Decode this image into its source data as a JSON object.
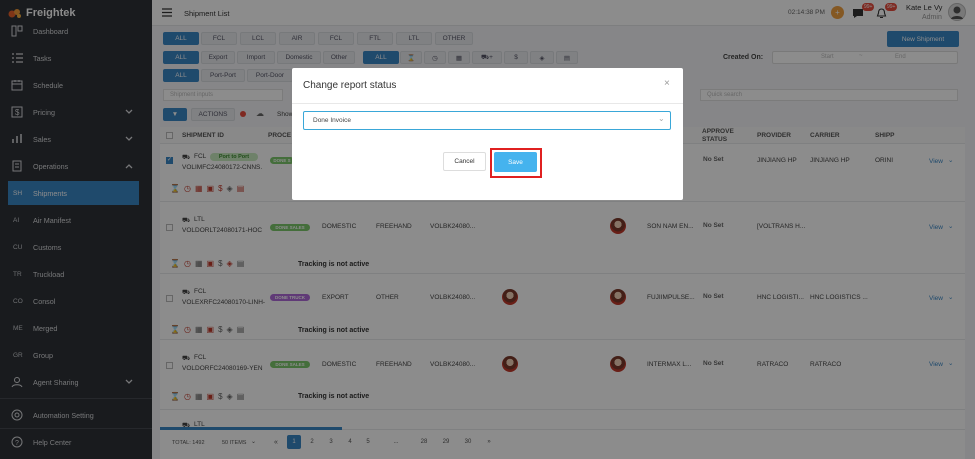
{
  "sidebar": {
    "brand": "Freightek",
    "items": [
      {
        "label": "Dashboard",
        "icon": "dashboard-icon"
      },
      {
        "label": "Tasks",
        "icon": "tasks-icon"
      },
      {
        "label": "Schedule",
        "icon": "calendar-icon"
      },
      {
        "label": "Pricing",
        "icon": "pricing-icon",
        "chevron": "down"
      },
      {
        "label": "Sales",
        "icon": "sales-icon",
        "chevron": "down"
      },
      {
        "label": "Operations",
        "icon": "operations-icon",
        "chevron": "up"
      }
    ],
    "sub_items": [
      {
        "abbr": "SH",
        "label": "Shipments",
        "active": true
      },
      {
        "abbr": "AI",
        "label": "Air Manifest"
      },
      {
        "abbr": "CU",
        "label": "Customs"
      },
      {
        "abbr": "TR",
        "label": "Truckload"
      },
      {
        "abbr": "CO",
        "label": "Consol"
      },
      {
        "abbr": "ME",
        "label": "Merged"
      },
      {
        "abbr": "GR",
        "label": "Group"
      }
    ],
    "agent_sharing": "Agent Sharing",
    "automation_setting": "Automation Setting",
    "help_center": "Help Center"
  },
  "topbar": {
    "title": "Shipment List",
    "time": "02:14:38 PM",
    "msg_badge": "99+",
    "notif_badge": "99+",
    "user_name": "Kate Le Vy",
    "user_role": "Admin"
  },
  "filters": {
    "mode_tabs": [
      "ALL",
      "FCL",
      "LCL",
      "AIR",
      "FCL",
      "FTL",
      "LTL",
      "OTHER"
    ],
    "type_tabs": [
      "ALL",
      "Export",
      "Import",
      "Domestic",
      "Other"
    ],
    "icon_tabs_all": "ALL",
    "scope_tabs": [
      "ALL",
      "Port-Port",
      "Port-Door"
    ],
    "created_on": "Created On:",
    "start_placeholder": "Start",
    "end_placeholder": "End",
    "shipment_search_placeholder": "Shipment inputs",
    "quick_search_placeholder": "Quick search",
    "actions": "ACTIONS",
    "show": "Show",
    "new_shipment": "New Shipment"
  },
  "table": {
    "headers": [
      "SHIPMENT ID",
      "PROCE",
      "APPROVE STATUS",
      "PROVIDER",
      "CARRIER",
      "SHIPP"
    ],
    "rows": [
      {
        "mode": "FCL",
        "tag": "Port to Port",
        "id": "VOLIMFC24080172-CNNS.",
        "badge": "DONE S",
        "type": "",
        "route": "",
        "booking": "",
        "prov": "",
        "approve": "No Set",
        "provider": "JINJIANG HP",
        "carrier": "JINJIANG HP",
        "shipper": "ORINI",
        "tracking": "",
        "checked": true
      },
      {
        "mode": "LTL",
        "tag": "",
        "id": "VOLDORLT24080171-HOC",
        "badge": "DONE SALES",
        "type": "DOMESTIC",
        "route": "FREEHAND",
        "booking": "VOLBK24080...",
        "prov": "SON NAM EN...",
        "approve": "No Set",
        "provider": "[VOLTRANS H...",
        "carrier": "",
        "shipper": "",
        "tracking": "Tracking is not active",
        "checked": false
      },
      {
        "mode": "FCL",
        "tag": "",
        "id": "VOLEXRFC24080170-LINH-",
        "badge": "DONE TRUCK",
        "type": "EXPORT",
        "route": "OTHER",
        "booking": "VOLBK24080...",
        "prov": "FUJIIMPULSE...",
        "approve": "No Set",
        "provider": "HNC LOGISTI...",
        "carrier": "HNC LOGISTICS ...",
        "shipper": "",
        "tracking": "Tracking is not active",
        "checked": false
      },
      {
        "mode": "FCL",
        "tag": "",
        "id": "VOLDORFC24080169-YEN",
        "badge": "DONE SALES",
        "type": "DOMESTIC",
        "route": "FREEHAND",
        "booking": "VOLBK24080...",
        "prov": "INTERMAX L...",
        "approve": "No Set",
        "provider": "RATRACO",
        "carrier": "RATRACO",
        "shipper": "",
        "tracking": "Tracking is not active",
        "checked": false
      },
      {
        "mode": "LTL",
        "tag": "",
        "id": "",
        "badge": "",
        "type": "",
        "route": "",
        "booking": "",
        "prov": "",
        "approve": "",
        "provider": "",
        "carrier": "",
        "shipper": "",
        "tracking": "",
        "checked": false
      }
    ],
    "view_label": "View"
  },
  "footer": {
    "total": "TOTAL: 1492",
    "per_page": "50 ITEMS",
    "pages": [
      "1",
      "2",
      "3",
      "4",
      "5",
      "...",
      "28",
      "29",
      "30"
    ],
    "prev": "«",
    "next": "»"
  },
  "modal": {
    "title": "Change report status",
    "selected": "Done Invoice",
    "cancel": "Cancel",
    "save": "Save"
  },
  "colors": {
    "sidebar_bg": "#2f3237",
    "accent": "#3a87c5",
    "save_button": "#45b3ee",
    "highlight_box": "#e02020",
    "badge_green": "#7cc96c",
    "badge_purple": "#b06ad9"
  }
}
